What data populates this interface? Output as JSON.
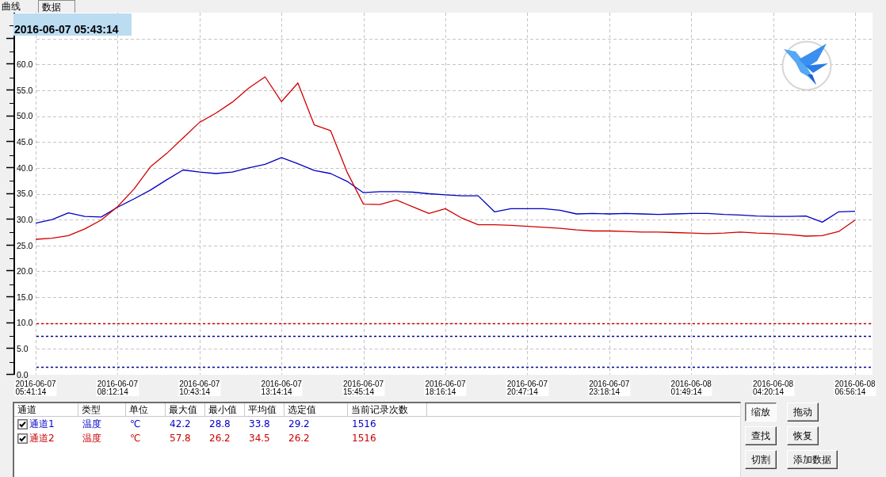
{
  "tabs": [
    {
      "label": "曲线",
      "selected": true
    },
    {
      "label": "数据",
      "selected": false
    }
  ],
  "chart": {
    "cursor_time": "2016-06-07 05:43:14",
    "chart_data": {
      "type": "line",
      "categories": [
        "2016-06-07 05:41:14",
        null,
        null,
        null,
        null,
        "2016-06-07 08:12:14",
        null,
        null,
        null,
        null,
        "2016-06-07 10:43:14",
        null,
        null,
        null,
        null,
        "2016-06-07 13:14:14",
        null,
        null,
        null,
        null,
        "2016-06-07 15:45:14",
        null,
        null,
        null,
        null,
        "2016-06-07 18:16:14",
        null,
        null,
        null,
        null,
        "2016-06-07 20:47:14",
        null,
        null,
        null,
        null,
        "2016-06-07 23:18:14",
        null,
        null,
        null,
        null,
        "2016-06-08 01:49:14",
        null,
        null,
        null,
        null,
        "2016-06-08 04:20:14",
        null,
        null,
        null,
        null,
        "2016-06-08 06:56:14"
      ],
      "series": [
        {
          "color": "#0000c0",
          "values": [
            29.3,
            30.0,
            31.3,
            30.6,
            30.5,
            32.4,
            34.0,
            35.7,
            37.7,
            39.6,
            39.2,
            38.9,
            39.2,
            40.0,
            40.7,
            42.0,
            40.8,
            39.5,
            38.9,
            37.4,
            35.2,
            35.4,
            35.4,
            35.3,
            35.0,
            34.8,
            34.6,
            34.6,
            31.5,
            32.1,
            32.1,
            32.1,
            31.8,
            31.1,
            31.2,
            31.1,
            31.2,
            31.1,
            31.0,
            31.1,
            31.2,
            31.2,
            31.0,
            30.9,
            30.7,
            30.6,
            30.6,
            30.7,
            29.5,
            31.5,
            31.6
          ]
        },
        {
          "color": "#d00000",
          "values": [
            26.2,
            26.4,
            26.9,
            28.2,
            29.9,
            32.5,
            35.9,
            40.2,
            42.8,
            45.8,
            48.8,
            50.6,
            52.7,
            55.4,
            57.6,
            52.8,
            56.4,
            48.3,
            47.2,
            39.2,
            33.0,
            32.9,
            33.8,
            32.5,
            31.2,
            32.1,
            30.3,
            29.0,
            29.0,
            28.9,
            28.7,
            28.5,
            28.3,
            28.0,
            27.8,
            27.8,
            27.7,
            27.6,
            27.6,
            27.5,
            27.4,
            27.3,
            27.4,
            27.6,
            27.4,
            27.3,
            27.1,
            26.8,
            26.9,
            27.7,
            29.9
          ]
        }
      ],
      "ylim": [
        0,
        70
      ],
      "yticks": [
        {
          "value": 0,
          "label": "0.0"
        },
        {
          "value": 5,
          "label": "5.0"
        },
        {
          "value": 10,
          "label": "10.0"
        },
        {
          "value": 15,
          "label": "15.0"
        },
        {
          "value": 20,
          "label": "20.0"
        },
        {
          "value": 25,
          "label": "25.0"
        },
        {
          "value": 30,
          "label": "30.0"
        },
        {
          "value": 35,
          "label": "35.0"
        },
        {
          "value": 40,
          "label": "40.0"
        },
        {
          "value": 45,
          "label": "45.0"
        },
        {
          "value": 50,
          "label": "50.0"
        },
        {
          "value": 55,
          "label": "55.0"
        },
        {
          "value": 60,
          "label": "60.0"
        }
      ],
      "grid": true,
      "ref_lines": [
        {
          "axis": "y",
          "value": 10,
          "color": "#cc0000"
        },
        {
          "axis": "y",
          "value": 7.5,
          "color": "#000099"
        },
        {
          "axis": "y",
          "value": 1.5,
          "color": "#000099"
        }
      ]
    }
  },
  "table": {
    "columns": [
      "通道",
      "类型",
      "单位",
      "最大值",
      "最小值",
      "平均值",
      "选定值",
      "当前记录次数"
    ],
    "rows": [
      {
        "checked": true,
        "color": "#0000c8",
        "cells": [
          "通道1",
          "温度",
          "℃",
          "42.2",
          "28.8",
          "33.8",
          "29.2",
          "1516"
        ]
      },
      {
        "checked": true,
        "color": "#cc0000",
        "cells": [
          "通道2",
          "温度",
          "℃",
          "57.8",
          "26.2",
          "34.5",
          "26.2",
          "1516"
        ]
      }
    ]
  },
  "buttons": [
    {
      "label": "缩放",
      "pressed": true
    },
    {
      "label": "拖动",
      "pressed": false
    },
    {
      "label": "查找",
      "pressed": false
    },
    {
      "label": "恢复",
      "pressed": false
    },
    {
      "label": "切割",
      "pressed": false
    },
    {
      "label": "添加数据",
      "pressed": false
    }
  ]
}
